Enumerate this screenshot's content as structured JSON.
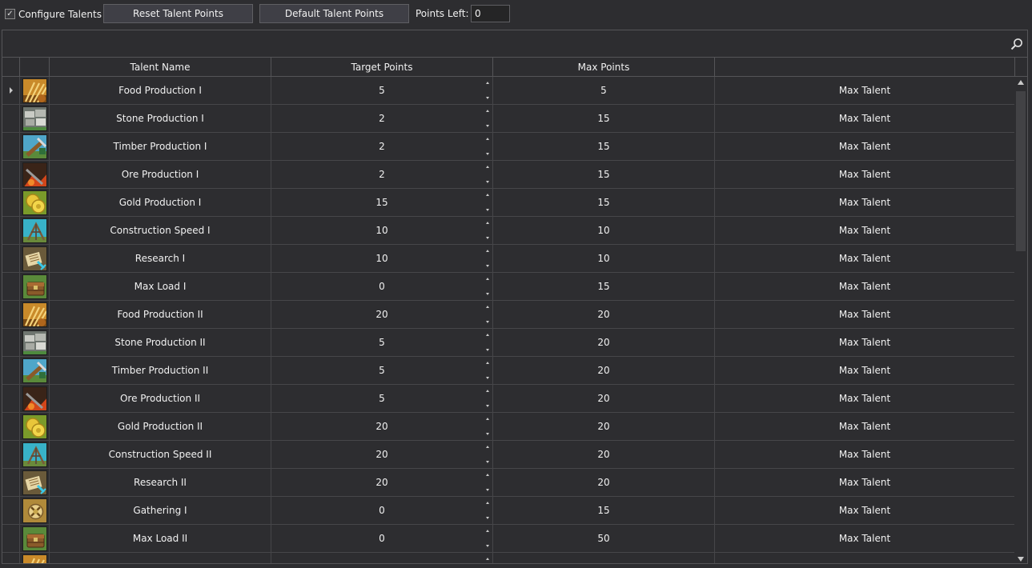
{
  "toolbar": {
    "configure_label": "Configure Talents",
    "configure_checked": true,
    "reset_label": "Reset Talent Points",
    "default_label": "Default Talent Points",
    "points_left_label": "Points Left:",
    "points_left_value": "0"
  },
  "columns": {
    "name": "Talent Name",
    "target": "Target Points",
    "max": "Max Points",
    "action": ""
  },
  "rows": [
    {
      "name": "Food Production I",
      "target": "5",
      "max": "5",
      "action": "Max Talent",
      "icon": "food-icon",
      "current": true
    },
    {
      "name": "Stone Production I",
      "target": "2",
      "max": "15",
      "action": "Max Talent",
      "icon": "stone-icon"
    },
    {
      "name": "Timber Production I",
      "target": "2",
      "max": "15",
      "action": "Max Talent",
      "icon": "timber-icon"
    },
    {
      "name": "Ore Production I",
      "target": "2",
      "max": "15",
      "action": "Max Talent",
      "icon": "ore-icon"
    },
    {
      "name": "Gold Production I",
      "target": "15",
      "max": "15",
      "action": "Max Talent",
      "icon": "gold-icon"
    },
    {
      "name": "Construction Speed I",
      "target": "10",
      "max": "10",
      "action": "Max Talent",
      "icon": "construction-icon"
    },
    {
      "name": "Research I",
      "target": "10",
      "max": "10",
      "action": "Max Talent",
      "icon": "research-icon"
    },
    {
      "name": "Max Load I",
      "target": "0",
      "max": "15",
      "action": "Max Talent",
      "icon": "load-icon"
    },
    {
      "name": "Food Production II",
      "target": "20",
      "max": "20",
      "action": "Max Talent",
      "icon": "food-icon"
    },
    {
      "name": "Stone Production II",
      "target": "5",
      "max": "20",
      "action": "Max Talent",
      "icon": "stone-icon"
    },
    {
      "name": "Timber Production II",
      "target": "5",
      "max": "20",
      "action": "Max Talent",
      "icon": "timber-icon"
    },
    {
      "name": "Ore Production II",
      "target": "5",
      "max": "20",
      "action": "Max Talent",
      "icon": "ore-icon"
    },
    {
      "name": "Gold Production II",
      "target": "20",
      "max": "20",
      "action": "Max Talent",
      "icon": "gold-icon"
    },
    {
      "name": "Construction Speed II",
      "target": "20",
      "max": "20",
      "action": "Max Talent",
      "icon": "construction-icon"
    },
    {
      "name": "Research II",
      "target": "20",
      "max": "20",
      "action": "Max Talent",
      "icon": "research-icon"
    },
    {
      "name": "Gathering I",
      "target": "0",
      "max": "15",
      "action": "Max Talent",
      "icon": "gathering-icon"
    },
    {
      "name": "Max Load II",
      "target": "0",
      "max": "50",
      "action": "Max Talent",
      "icon": "load-icon"
    },
    {
      "name": "",
      "target": "",
      "max": "",
      "action": "",
      "icon": "food-icon"
    }
  ],
  "colors": {
    "background": "#2d2d30",
    "border": "#555558",
    "text": "#f1f1f1"
  }
}
